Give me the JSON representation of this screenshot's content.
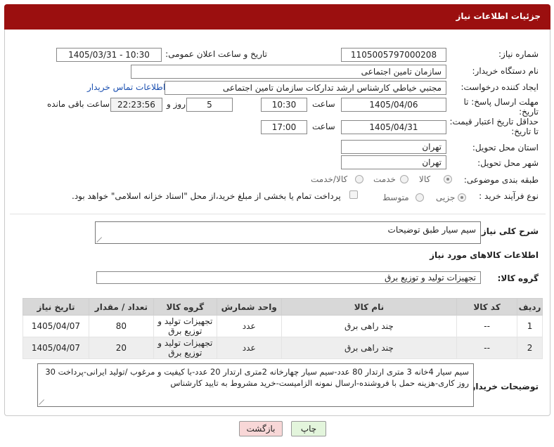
{
  "header": {
    "title": "جزئیات اطلاعات نیاز"
  },
  "form": {
    "need_number_label": "شماره نیاز:",
    "need_number": "1105005797000208",
    "announce_label": "تاریخ و ساعت اعلان عمومی:",
    "announce_value": "1405/03/31 - 10:30",
    "buyer_label": "نام دستگاه خریدار:",
    "buyer_value": "سازمان تامین اجتماعی",
    "creator_label": "ایجاد کننده درخواست:",
    "creator_value": "مجتبي خياطي كارشناس ارشد تداركات سازمان تامین اجتماعی",
    "contact_link": "اطلاعات تماس خریدار",
    "deadline_label_1": "مهلت ارسال پاسخ: تا",
    "deadline_label_2": "تاریخ:",
    "deadline_date": "1405/04/06",
    "time_label": "ساعت",
    "deadline_time": "10:30",
    "days_value": "5",
    "days_label": "روز و",
    "remain_time": "22:23:56",
    "remain_label": "ساعت باقی مانده",
    "price_label_1": "حداقل تاریخ اعتبار قیمت:",
    "price_label_2": "تا تاریخ:",
    "price_date": "1405/04/31",
    "price_time": "17:00",
    "province_label": "استان محل تحویل:",
    "province_value": "تهران",
    "city_label": "شهر محل تحویل:",
    "city_value": "تهران",
    "category_label": "طبقه بندی موضوعی:",
    "cat_opt_goods": "کالا",
    "cat_opt_service": "خدمت",
    "cat_opt_both": "کالا/خدمت",
    "process_label": "نوع فرآیند خرید :",
    "proc_opt_partial": "جزیی",
    "proc_opt_medium": "متوسط",
    "payment_note": "پرداخت تمام یا بخشی از مبلغ خرید،از محل \"اسناد خزانه اسلامی\" خواهد بود."
  },
  "summary": {
    "label": "شرح کلی نیاز:",
    "value": "سیم سیار طبق توضیحات"
  },
  "goods": {
    "section_title": "اطلاعات کالاهای مورد نیاز",
    "group_label": "گروه کالا:",
    "group_value": "تجهیزات تولید و توزیع برق",
    "columns": [
      "ردیف",
      "کد کالا",
      "نام کالا",
      "واحد شمارش",
      "گروه کالا",
      "تعداد / مقدار",
      "تاریخ نیاز"
    ],
    "rows": [
      {
        "idx": "1",
        "code": "--",
        "name": "چند راهی برق",
        "unit": "عدد",
        "group_1": "تجهیزات تولید و",
        "group_2": "توزیع برق",
        "qty": "80",
        "date": "1405/04/07"
      },
      {
        "idx": "2",
        "code": "--",
        "name": "چند راهی برق",
        "unit": "عدد",
        "group_1": "تجهیزات تولید و",
        "group_2": "توزیع برق",
        "qty": "20",
        "date": "1405/04/07"
      }
    ]
  },
  "buyer_notes": {
    "label": "توضیحات خریدار:",
    "line1": "سیم سیار 4خانه 3 متری ارتدار 80 عدد-سیم سیار چهارخانه 2متری ارتدار 20 عدد-با کیفیت و مرغوب /تولید ایرانی-پرداخت 30",
    "line2": "روز کاری-هزینه حمل با فروشنده-ارسال نمونه الزامیست-خرید مشروط به تایید کارشناس"
  },
  "buttons": {
    "print": "چاپ",
    "back": "بازگشت"
  },
  "colors": {
    "header_bg": "#9b0f0f",
    "link": "#1a4fb0",
    "back_btn_bg": "#f8d7d7",
    "print_btn_bg": "#e3f5dc"
  }
}
